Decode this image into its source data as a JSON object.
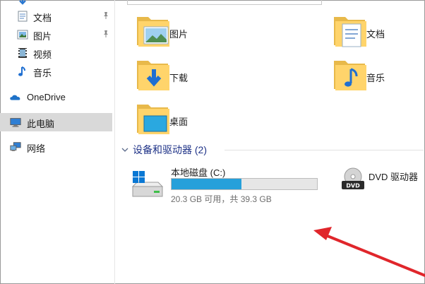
{
  "sidebar": {
    "items": [
      {
        "label": "文档",
        "icon": "document-folder-icon",
        "pinned": true
      },
      {
        "label": "图片",
        "icon": "pictures-folder-icon",
        "pinned": true
      },
      {
        "label": "视频",
        "icon": "video-folder-icon",
        "pinned": false
      },
      {
        "label": "音乐",
        "icon": "music-folder-icon",
        "pinned": false
      },
      {
        "label": "OneDrive",
        "icon": "onedrive-cloud-icon"
      },
      {
        "label": "此电脑",
        "icon": "this-pc-icon",
        "selected": true
      },
      {
        "label": "网络",
        "icon": "network-icon"
      }
    ]
  },
  "folders": [
    {
      "label": "图片",
      "icon": "pictures-folder-icon"
    },
    {
      "label": "文档",
      "icon": "documents-folder-icon"
    },
    {
      "label": "下载",
      "icon": "downloads-folder-icon"
    },
    {
      "label": "音乐",
      "icon": "music-folder-icon"
    },
    {
      "label": "桌面",
      "icon": "desktop-folder-icon"
    }
  ],
  "devices": {
    "header": "设备和驱动器 (2)",
    "local_disk": {
      "name": "本地磁盘 (C:)",
      "size_text": "20.3 GB 可用，共 39.3 GB",
      "used_fraction": 0.48
    },
    "dvd": {
      "name": "DVD 驱动器",
      "badge": "DVD"
    }
  },
  "colors": {
    "selection": "#d9d9d9",
    "header_text": "#1e3287",
    "drive_bar": "#26a0da",
    "annotation_arrow": "#e0262b"
  }
}
